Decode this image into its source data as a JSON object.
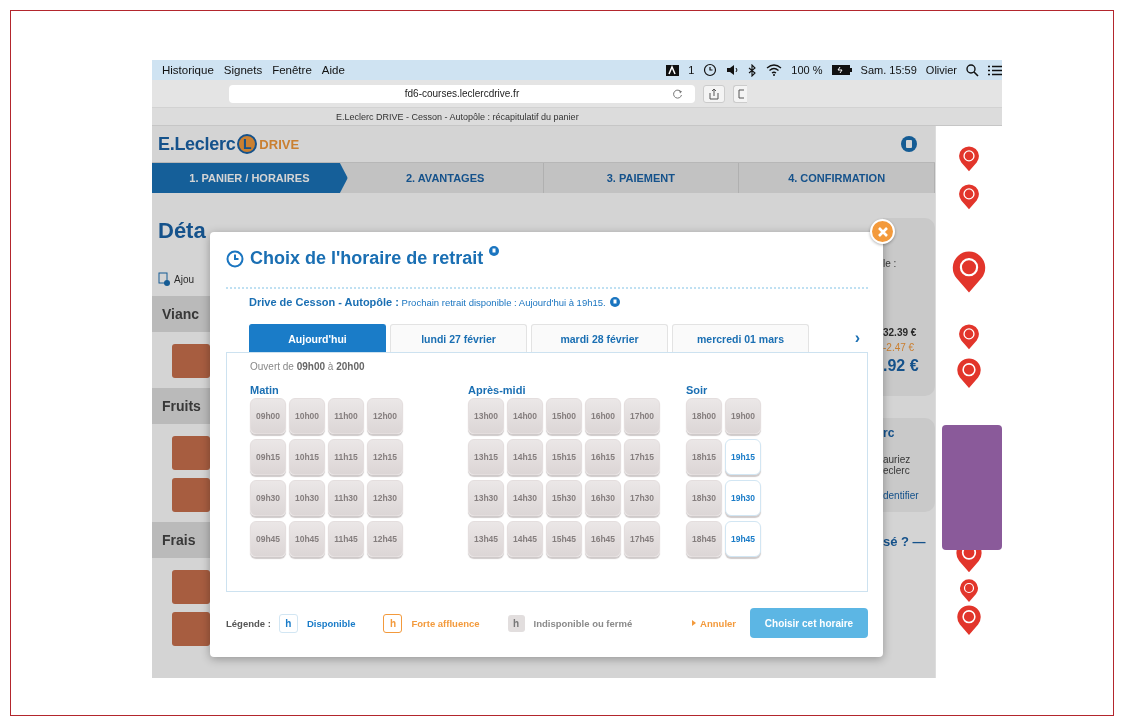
{
  "menu_bar": {
    "menus": [
      "Historique",
      "Signets",
      "Fenêtre",
      "Aide"
    ],
    "input_source": "1",
    "battery": "100 %",
    "clock": "Sam. 15:59",
    "user": "Olivier"
  },
  "browser": {
    "url": "fd6-courses.leclercdrive.fr",
    "page_title": "E.Leclerc DRIVE - Cesson - Autopôle : récapitulatif du panier"
  },
  "site": {
    "brand": "E.Leclerc",
    "badge": "L",
    "product": "DRIVE"
  },
  "steps": [
    {
      "label": "1. PANIER / HORAIRES",
      "selected": true
    },
    {
      "label": "2. AVANTAGES",
      "selected": false
    },
    {
      "label": "3. PAIEMENT",
      "selected": false
    },
    {
      "label": "4. CONFIRMATION",
      "selected": false
    }
  ],
  "background_left": [
    {
      "kind": "heading",
      "text": "Déta"
    },
    {
      "kind": "link",
      "text": "Ajou"
    },
    {
      "kind": "category",
      "text": "Vianc"
    },
    {
      "kind": "photo"
    },
    {
      "kind": "category",
      "text": "Fruits"
    },
    {
      "kind": "photo"
    },
    {
      "kind": "photo"
    },
    {
      "kind": "category",
      "text": "Frais"
    },
    {
      "kind": "photo"
    },
    {
      "kind": "photo"
    }
  ],
  "background_right": [
    {
      "kind": "note",
      "text": "le :"
    },
    {
      "kind": "price",
      "text": "32.39 €"
    },
    {
      "kind": "discount",
      "text": "-2.47 €"
    },
    {
      "kind": "total",
      "text": ".92 €"
    },
    {
      "kind": "title",
      "text": "rc"
    },
    {
      "kind": "note",
      "text": "auriez"
    },
    {
      "kind": "note",
      "text": "eclerc"
    },
    {
      "kind": "link",
      "text": "dentifier"
    },
    {
      "kind": "heading",
      "text": "sé ? —"
    }
  ],
  "modal": {
    "title": "Choix de l'horaire de retrait",
    "store_line": "**Drive de Cesson - Autopôle :** Prochain retrait disponible : Aujourd'hui à 19h15.",
    "tabs": [
      {
        "label": "Aujourd'hui",
        "selected": true
      },
      {
        "label": "lundi 27 février",
        "selected": false
      },
      {
        "label": "mardi 28 février",
        "selected": false
      },
      {
        "label": "mercredi 01 mars",
        "selected": false
      }
    ],
    "next": "›",
    "opening": "Ouvert de **09h00** à **20h00**",
    "groups": [
      {
        "title": "Matin",
        "rows": [
          [
            {
              "label": "09h00",
              "available": false
            },
            {
              "label": "10h00",
              "available": false
            },
            {
              "label": "11h00",
              "available": false
            },
            {
              "label": "12h00",
              "available": false
            }
          ],
          [
            {
              "label": "09h15",
              "available": false
            },
            {
              "label": "10h15",
              "available": false
            },
            {
              "label": "11h15",
              "available": false
            },
            {
              "label": "12h15",
              "available": false
            }
          ],
          [
            {
              "label": "09h30",
              "available": false
            },
            {
              "label": "10h30",
              "available": false
            },
            {
              "label": "11h30",
              "available": false
            },
            {
              "label": "12h30",
              "available": false
            }
          ],
          [
            {
              "label": "09h45",
              "available": false
            },
            {
              "label": "10h45",
              "available": false
            },
            {
              "label": "11h45",
              "available": false
            },
            {
              "label": "12h45",
              "available": false
            }
          ]
        ]
      },
      {
        "title": "Après-midi",
        "rows": [
          [
            {
              "label": "13h00",
              "available": false
            },
            {
              "label": "14h00",
              "available": false
            },
            {
              "label": "15h00",
              "available": false
            },
            {
              "label": "16h00",
              "available": false
            },
            {
              "label": "17h00",
              "available": false
            }
          ],
          [
            {
              "label": "13h15",
              "available": false
            },
            {
              "label": "14h15",
              "available": false
            },
            {
              "label": "15h15",
              "available": false
            },
            {
              "label": "16h15",
              "available": false
            },
            {
              "label": "17h15",
              "available": false
            }
          ],
          [
            {
              "label": "13h30",
              "available": false
            },
            {
              "label": "14h30",
              "available": false
            },
            {
              "label": "15h30",
              "available": false
            },
            {
              "label": "16h30",
              "available": false
            },
            {
              "label": "17h30",
              "available": false
            }
          ],
          [
            {
              "label": "13h45",
              "available": false
            },
            {
              "label": "14h45",
              "available": false
            },
            {
              "label": "15h45",
              "available": false
            },
            {
              "label": "16h45",
              "available": false
            },
            {
              "label": "17h45",
              "available": false
            }
          ]
        ]
      },
      {
        "title": "Soir",
        "rows": [
          [
            {
              "label": "18h00",
              "available": false
            },
            {
              "label": "19h00",
              "available": false
            }
          ],
          [
            {
              "label": "18h15",
              "available": false
            },
            {
              "label": "19h15",
              "available": true
            }
          ],
          [
            {
              "label": "18h30",
              "available": false
            },
            {
              "label": "19h30",
              "available": true
            }
          ],
          [
            {
              "label": "18h45",
              "available": false
            },
            {
              "label": "19h45",
              "available": true
            }
          ]
        ]
      }
    ],
    "legend_label": "Légende :",
    "legend": [
      {
        "kind": "available",
        "symbol": "h",
        "text": "Disponible"
      },
      {
        "kind": "busy",
        "symbol": "h",
        "text": "Forte affluence"
      },
      {
        "kind": "unavailable",
        "symbol": "h",
        "text": "Indisponible ou fermé"
      }
    ],
    "cancel": "Annuler",
    "confirm": "Choisir cet horaire"
  }
}
